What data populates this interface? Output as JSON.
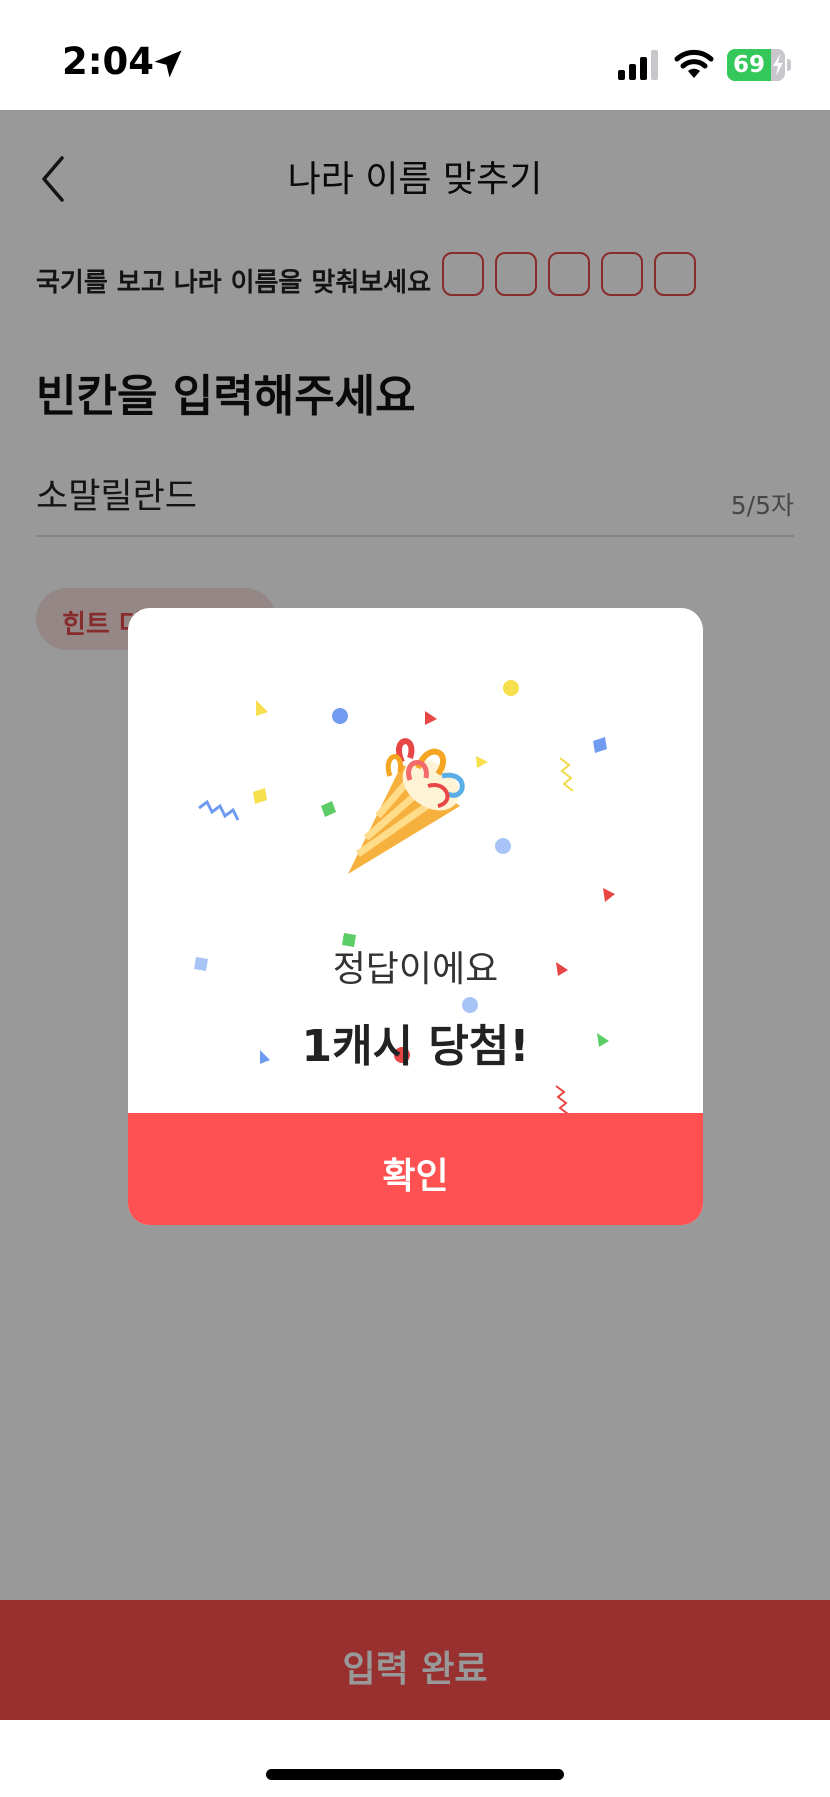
{
  "status_bar": {
    "time": "2:04",
    "battery": "69",
    "battery_color": "#34c759"
  },
  "header": {
    "title": "나라 이름 맞추기",
    "back_icon": "chevron-left-icon"
  },
  "quiz": {
    "instruction": "국기를 보고 나라 이름을 맞춰보세요",
    "slot_count": 5,
    "heading": "빈칸을 입력해주세요",
    "answer_value": "소말릴란드",
    "char_counter": "5/5자",
    "hint_label": "힌트 더보기"
  },
  "bottom_button": {
    "label": "입력 완료",
    "color": "#ff5151"
  },
  "modal": {
    "icon": "party-popper-icon",
    "message": "정답이에요",
    "reward": "1캐시 당첨!",
    "confirm_label": "확인",
    "accent_color": "#ff5151"
  }
}
